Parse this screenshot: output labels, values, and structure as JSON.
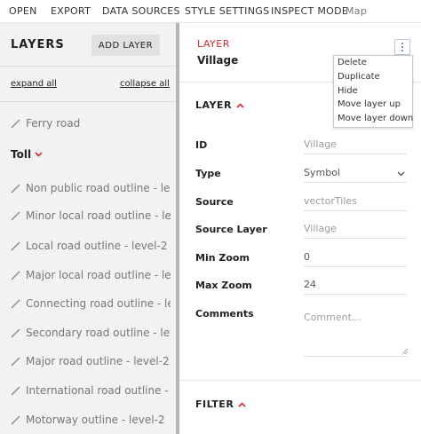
{
  "menu": {
    "items": [
      "OPEN",
      "EXPORT",
      "DATA SOURCES",
      "STYLE SETTINGS",
      "INSPECT MODE"
    ],
    "app_title": "Map"
  },
  "sidebar": {
    "title": "LAYERS",
    "add_layer_label": "ADD LAYER",
    "expand_all": "expand all",
    "collapse_all": "collapse all",
    "items": [
      {
        "label": "Ferry road",
        "kind": "layer"
      },
      {
        "label": "Toll",
        "kind": "group"
      },
      {
        "label": "Non public road outline - lev...",
        "kind": "layer"
      },
      {
        "label": "Minor local road outline - le...",
        "kind": "layer"
      },
      {
        "label": "Local road outline - level-2",
        "kind": "layer"
      },
      {
        "label": "Major local road outline - le...",
        "kind": "layer"
      },
      {
        "label": "Connecting road outline - le...",
        "kind": "layer"
      },
      {
        "label": "Secondary road outline - lev...",
        "kind": "layer"
      },
      {
        "label": "Major road outline - level-2",
        "kind": "layer"
      },
      {
        "label": "International road outline - ...",
        "kind": "layer"
      },
      {
        "label": "Motorway outline - level-2",
        "kind": "layer"
      }
    ]
  },
  "editor": {
    "section_label": "LAYER",
    "layer_name": "Village",
    "layer_section": "LAYER",
    "filter_section": "FILTER",
    "fields": {
      "id": {
        "label": "ID",
        "placeholder": "Village"
      },
      "type": {
        "label": "Type",
        "value": "Symbol"
      },
      "source": {
        "label": "Source",
        "placeholder": "vectorTiles"
      },
      "source_layer": {
        "label": "Source Layer",
        "placeholder": "Village"
      },
      "min_zoom": {
        "label": "Min Zoom",
        "value": "0"
      },
      "max_zoom": {
        "label": "Max Zoom",
        "value": "24"
      },
      "comments": {
        "label": "Comments",
        "placeholder": "Comment..."
      }
    }
  },
  "context_menu": {
    "items": [
      "Delete",
      "Duplicate",
      "Hide",
      "Move layer up",
      "Move layer down"
    ]
  },
  "colors": {
    "accent_red": "#d12a2a",
    "sidebar_bg": "#f2f2f2",
    "button_bg": "#e1e1e1"
  }
}
